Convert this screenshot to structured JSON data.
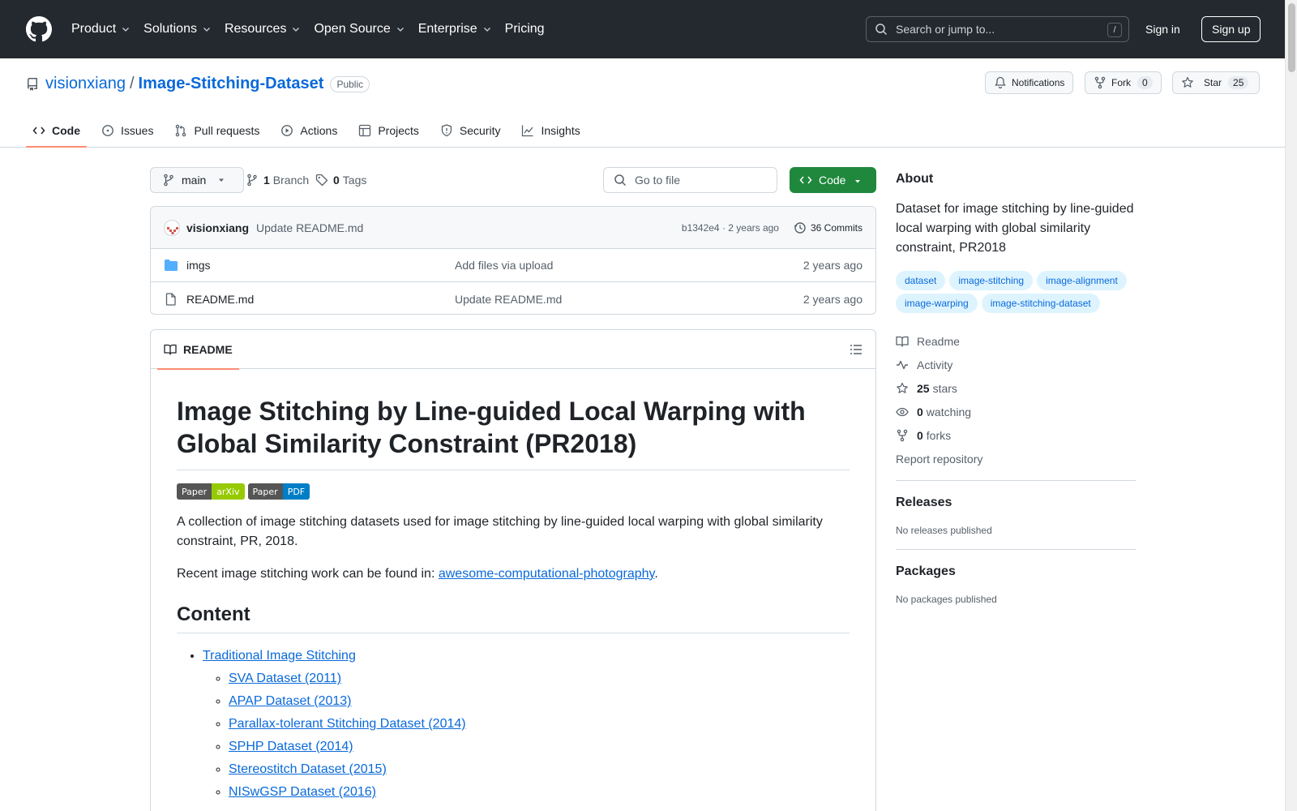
{
  "header": {
    "nav": [
      "Product",
      "Solutions",
      "Resources",
      "Open Source",
      "Enterprise",
      "Pricing"
    ],
    "search_placeholder": "Search or jump to...",
    "search_shortcut": "/",
    "signin": "Sign in",
    "signup": "Sign up"
  },
  "repo": {
    "owner": "visionxiang",
    "separator": "/",
    "name": "Image-Stitching-Dataset",
    "visibility": "Public",
    "notifications_label": "Notifications",
    "fork_label": "Fork",
    "fork_count": "0",
    "star_label": "Star",
    "star_count": "25"
  },
  "tabs": [
    "Code",
    "Issues",
    "Pull requests",
    "Actions",
    "Projects",
    "Security",
    "Insights"
  ],
  "branchbar": {
    "branch": "main",
    "branch_count": "1",
    "branch_label": "Branch",
    "tag_count": "0",
    "tag_label": "Tags",
    "goto_placeholder": "Go to file",
    "code_button": "Code"
  },
  "commit": {
    "author": "visionxiang",
    "message": "Update README.md",
    "hash_time": "b1342e4 · 2 years ago",
    "commits": "36 Commits"
  },
  "files": [
    {
      "name": "imgs",
      "type": "folder",
      "message": "Add files via upload",
      "date": "2 years ago"
    },
    {
      "name": "README.md",
      "type": "file",
      "message": "Update README.md",
      "date": "2 years ago"
    }
  ],
  "readme": {
    "tab_label": "README",
    "title": "Image Stitching by Line-guided Local Warping with Global Similarity Constraint (PR2018)",
    "badges": [
      {
        "left": "Paper",
        "right": "arXiv",
        "color": "#97ca00"
      },
      {
        "left": "Paper",
        "right": "PDF",
        "color": "#007ec6"
      }
    ],
    "intro": "A collection of image stitching datasets used for image stitching by line-guided local warping with global similarity constraint, PR, 2018.",
    "recent_prefix": "Recent image stitching work can be found in: ",
    "recent_link": "awesome-computational-photography",
    "recent_suffix": ".",
    "content_heading": "Content",
    "toc_top": "Traditional Image Stitching",
    "toc_items": [
      "SVA Dataset (2011)",
      "APAP Dataset (2013)",
      "Parallax-tolerant Stitching Dataset (2014)",
      "SPHP Dataset (2014)",
      "Stereostitch Dataset (2015)",
      "NISwGSP Dataset (2016)"
    ]
  },
  "sidebar": {
    "about_title": "About",
    "description": "Dataset for image stitching by line-guided local warping with global similarity constraint, PR2018",
    "topics": [
      "dataset",
      "image-stitching",
      "image-alignment",
      "image-warping",
      "image-stitching-dataset"
    ],
    "readme_link": "Readme",
    "activity_link": "Activity",
    "stars_count": "25",
    "stars_label": "stars",
    "watching_count": "0",
    "watching_label": "watching",
    "forks_count": "0",
    "forks_label": "forks",
    "report_link": "Report repository",
    "releases_title": "Releases",
    "releases_note": "No releases published",
    "packages_title": "Packages",
    "packages_note": "No packages published"
  },
  "colors": {
    "header_bg": "#24292f",
    "link": "#0969da",
    "code_button": "#1f883d",
    "active_tab_underline": "#fd8c73",
    "folder_icon": "#54aeff"
  }
}
